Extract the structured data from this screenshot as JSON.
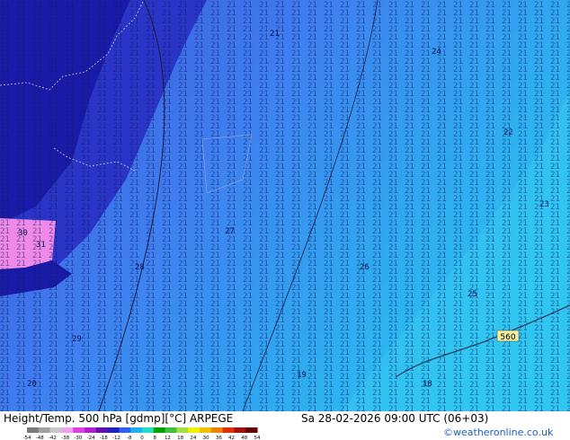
{
  "map": {
    "contour_label": "560",
    "field_numbers": [
      "21",
      "24",
      "22",
      "23",
      "25",
      "26",
      "27",
      "28",
      "29",
      "20",
      "19",
      "18",
      "30",
      "31"
    ]
  },
  "footer": {
    "title": "Height/Temp. 500 hPa [gdmp][°C] ARPEGE",
    "datetime": "Sa 28-02-2026 09:00 UTC (06+03)",
    "credit": "©weatheronline.co.uk"
  },
  "scale": {
    "ticks": [
      "-54",
      "-48",
      "-42",
      "-38",
      "-30",
      "-24",
      "-18",
      "-12",
      "-8",
      "0",
      "8",
      "12",
      "18",
      "24",
      "30",
      "36",
      "42",
      "48",
      "54"
    ],
    "colors": [
      "#7a7a7a",
      "#a0a0a0",
      "#c8c8c8",
      "#f0a0f0",
      "#e040e0",
      "#b020d0",
      "#6010b0",
      "#2020c0",
      "#3060f0",
      "#20b0f0",
      "#20e0c0",
      "#00a000",
      "#40c040",
      "#a0e040",
      "#f0f000",
      "#f0c000",
      "#f08000",
      "#e03000",
      "#a01010",
      "#600000"
    ]
  }
}
